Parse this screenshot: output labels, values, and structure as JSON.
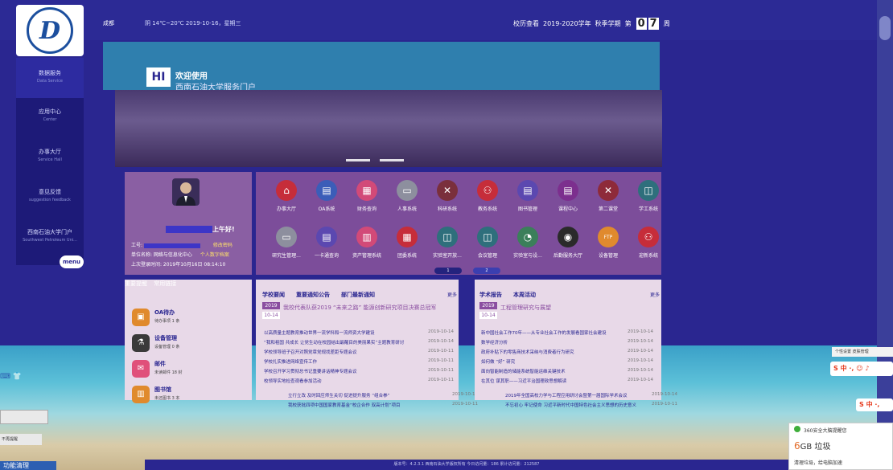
{
  "header": {
    "city": "成都",
    "weather": "阴 14℃~20℃  2019-10-16，星期三",
    "calendar_link": "校历查看",
    "school_year": "2019-2020学年",
    "semester": "秋季学期",
    "week_prefix": "第",
    "week_digit_1": "0",
    "week_digit_2": "7",
    "week_suffix": "周"
  },
  "logo": {
    "letter": "D"
  },
  "sidebar": {
    "items": [
      {
        "zh": "数据服务",
        "en": "Data Service"
      },
      {
        "zh": "应用中心",
        "en": "Center"
      },
      {
        "zh": "办事大厅",
        "en": "Service Hall"
      },
      {
        "zh": "意见反馈",
        "en": "suggestion feedback"
      },
      {
        "zh": "西南石油大学门户",
        "en": "Southwest Petroleum Uni..."
      }
    ],
    "menu_label": "menu"
  },
  "banner": {
    "icon_text": "HI",
    "welcome": "欢迎使用",
    "portal_name": "西南石油大学服务门户"
  },
  "user": {
    "greeting": "上午好!",
    "id_label": "工号:",
    "change_password": "修改密码",
    "unit": "单位名称:  网络与信息化中心",
    "personal_file": "个人数字档案",
    "last_login": "上次登录时间: 2019年10月16日 08:14:10"
  },
  "apps": [
    {
      "label": "办事大厅",
      "icon": "building-icon",
      "symbol": "⌂",
      "color": "#c62d3a"
    },
    {
      "label": "OA系统",
      "icon": "document-icon",
      "symbol": "▤",
      "color": "#3b5db8"
    },
    {
      "label": "财务查询",
      "icon": "calendar-icon",
      "symbol": "▦",
      "color": "#d24a78"
    },
    {
      "label": "人事系统",
      "icon": "id-card-icon",
      "symbol": "▭",
      "color": "#8d8f9e"
    },
    {
      "label": "科研系统",
      "icon": "tools-icon",
      "symbol": "✕",
      "color": "#7a2f3c"
    },
    {
      "label": "教务系统",
      "icon": "users-icon",
      "symbol": "⚇",
      "color": "#c62d3a"
    },
    {
      "label": "图书管理",
      "icon": "list-icon",
      "symbol": "▤",
      "color": "#5b48b0"
    },
    {
      "label": "课程中心",
      "icon": "list-icon",
      "symbol": "▤",
      "color": "#7c2f8e"
    },
    {
      "label": "第二课堂",
      "icon": "tools-icon",
      "symbol": "✕",
      "color": "#8e2a3a"
    },
    {
      "label": "学工系统",
      "icon": "chart-icon",
      "symbol": "◫",
      "color": "#2e6f7c"
    },
    {
      "label": "研究生管理...",
      "icon": "id-card-icon",
      "symbol": "▭",
      "color": "#8d8f9e"
    },
    {
      "label": "一卡通查询",
      "icon": "list-icon",
      "symbol": "▤",
      "color": "#5b48b0"
    },
    {
      "label": "资产管理系统",
      "icon": "book-icon",
      "symbol": "▥",
      "color": "#d24a78"
    },
    {
      "label": "团委系统",
      "icon": "calendar-icon",
      "symbol": "▦",
      "color": "#c62d3a"
    },
    {
      "label": "实验室开放...",
      "icon": "chart-icon",
      "symbol": "◫",
      "color": "#2e6f7c"
    },
    {
      "label": "会议管理",
      "icon": "chart-icon",
      "symbol": "◫",
      "color": "#2e6f7c"
    },
    {
      "label": "实验室与设...",
      "icon": "chat-icon",
      "symbol": "◔",
      "color": "#3b7f5a"
    },
    {
      "label": "后勤服务大厅",
      "icon": "target-icon",
      "symbol": "◉",
      "color": "#2a2a2a"
    },
    {
      "label": "设备管理",
      "icon": "ftp-icon",
      "symbol": "FTP",
      "color": "#e08a2d"
    },
    {
      "label": "迎新系统",
      "icon": "users-icon",
      "symbol": "⚇",
      "color": "#c62d3a"
    }
  ],
  "pager": {
    "page1": "1",
    "page2": "2"
  },
  "reminders": {
    "tab_important": "重要提醒",
    "tab_common": "常用链接",
    "items": [
      {
        "name": "OA待办",
        "sub": "待办事项 1 条",
        "icon": "oa-icon",
        "color": "#e08a2d",
        "symbol": "▣"
      },
      {
        "name": "设备管理",
        "sub": "设备管理 0 条",
        "icon": "flask-icon",
        "color": "#3a3a3a",
        "symbol": "⚗"
      },
      {
        "name": "邮件",
        "sub": "未读邮件 18 封",
        "icon": "mail-icon",
        "color": "#e0507a",
        "symbol": "✉"
      },
      {
        "name": "图书馆",
        "sub": "未还图书 3 本",
        "icon": "library-icon",
        "color": "#e08a2d",
        "symbol": "▥"
      }
    ]
  },
  "news": {
    "tabs": [
      "学校要闻",
      "重要通知公告",
      "部门最新通知"
    ],
    "more": "更多",
    "headline_year": "2019",
    "headline_date": "10-14",
    "headline_title": "我校代表队获2019 “未来之路” 能源创新研究项目决赛总冠军",
    "rows": [
      {
        "title": "以高质量主题教育推动世界一流学科和一流师资大学建设",
        "date": "2019-10-14"
      },
      {
        "title": "“我和祖国 共成长 让党生动在校园结出最醒目的美丽果实”主题教育研讨",
        "date": "2019-10-14"
      },
      {
        "title": "学校领导班子召开对照党章党规找差距专题会议",
        "date": "2019-10-11"
      },
      {
        "title": "学校扎实推进网络宣传工作",
        "date": "2019-10-11"
      },
      {
        "title": "学校召开学习贯彻总书记重要讲话精神专题会议",
        "date": "2019-10-11"
      },
      {
        "title": "校领导实地检查观看参加活动",
        "date": "2019-10-11"
      },
      {
        "title": "立行立改 及时回应师生关切 促进提升服务 “组合拳”",
        "date": "2019-10-11"
      },
      {
        "title": "我校获批四项中国国家教育基金“校企合作 双高计划”项目",
        "date": "2019-10-11"
      }
    ]
  },
  "science": {
    "tabs": [
      "学术报告",
      "本周活动"
    ],
    "more": "更多",
    "headline_year": "2019",
    "headline_date": "10-14",
    "headline_title": "工程管理研究与展望",
    "rows": [
      {
        "title": "新中国社会工作70年——从专业社会工作的发展看国家社会建设",
        "date": "2019-10-14"
      },
      {
        "title": "数学经济分析",
        "date": "2019-10-14"
      },
      {
        "title": "政府补贴下的零售商技术采纳与消费者行为研究",
        "date": "2019-10-14"
      },
      {
        "title": "如何做 “好” 研究",
        "date": "2019-10-14"
      },
      {
        "title": "面向智能制造的储能系统智能运维关键技术",
        "date": "2019-10-14"
      },
      {
        "title": "在其位 谋其职——习近平治国理政思想解读",
        "date": "2019-10-14"
      },
      {
        "title": "2019年全国高校力学与工程应用研讨会暨第一届国际学术会议",
        "date": "2019-10-14"
      },
      {
        "title": "不忘初心 牢记使命 习近平新时代中国特色社会主义思想的历史意义",
        "date": "2019-10-11"
      }
    ]
  },
  "footer": {
    "text": "版本号：4.2.3.1  西南石油大学版权所有  今日访问量：186  累计访问量：212587"
  },
  "taskbar": {
    "ime_text": "中 ·,  ☺  ♪",
    "ime_text2": "中 ·,",
    "ime_top": "个性设置   皮肤管理",
    "left_bottom": "不再提醒",
    "left_footer": "功能清理"
  },
  "security": {
    "title": "360安全大脑提醒您",
    "size_num": "6",
    "size_unit": "GB 垃圾",
    "desc": "清理垃圾，给电脑加速"
  }
}
